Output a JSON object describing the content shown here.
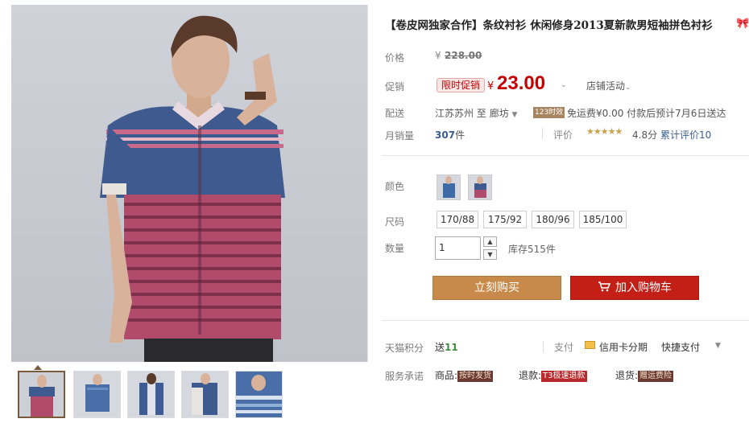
{
  "product": {
    "title": "【卷皮网独家合作】条纹衬衫 休闲修身2013夏新款男短袖拼色衬衫",
    "title_icon": "ribbon-icon"
  },
  "labels": {
    "price": "价格",
    "promo": "促销",
    "shipping": "配送",
    "monthly_sales": "月销量",
    "color": "颜色",
    "size": "尺码",
    "quantity": "数量",
    "tmall_points": "天猫积分",
    "service": "服务承诺"
  },
  "price": {
    "yen": "¥",
    "original": "228.00",
    "promo_badge": "限时促销",
    "current": "23.00",
    "shop_activity": "店铺活动"
  },
  "shipping": {
    "from": "江苏苏州",
    "to_word": "至",
    "destination": "廊坊",
    "tag": "123时效",
    "text": "免运费¥0.00 付款后预计7月6日送达"
  },
  "sales": {
    "count": "307",
    "unit": "件",
    "review_label": "评价",
    "stars": "★★★★★",
    "score": "4.8分",
    "review_count": "累计评价10"
  },
  "sizes": [
    "170/88",
    "175/92",
    "180/96",
    "185/100"
  ],
  "quantity": {
    "value": "1",
    "up": "▲",
    "down": "▼",
    "stock": "库存515件"
  },
  "buttons": {
    "buy_now": "立刻购买",
    "add_to_cart": "加入购物车"
  },
  "extras": {
    "points_prefix": "送",
    "points": "11",
    "pay_label": "支付",
    "credit_card": "信用卡分期",
    "quick_pay": "快捷支付"
  },
  "services": [
    {
      "label": "商品:",
      "tag": "按时发货"
    },
    {
      "label": "退款:",
      "tag": "T3极速退款"
    },
    {
      "label": "退货:",
      "tag": "赠运费险"
    }
  ],
  "colors": {
    "price_red": "#c40000",
    "buy_now": "#c88a4a",
    "add_to_cart": "#c41f16",
    "link_blue": "#3b5e91"
  }
}
